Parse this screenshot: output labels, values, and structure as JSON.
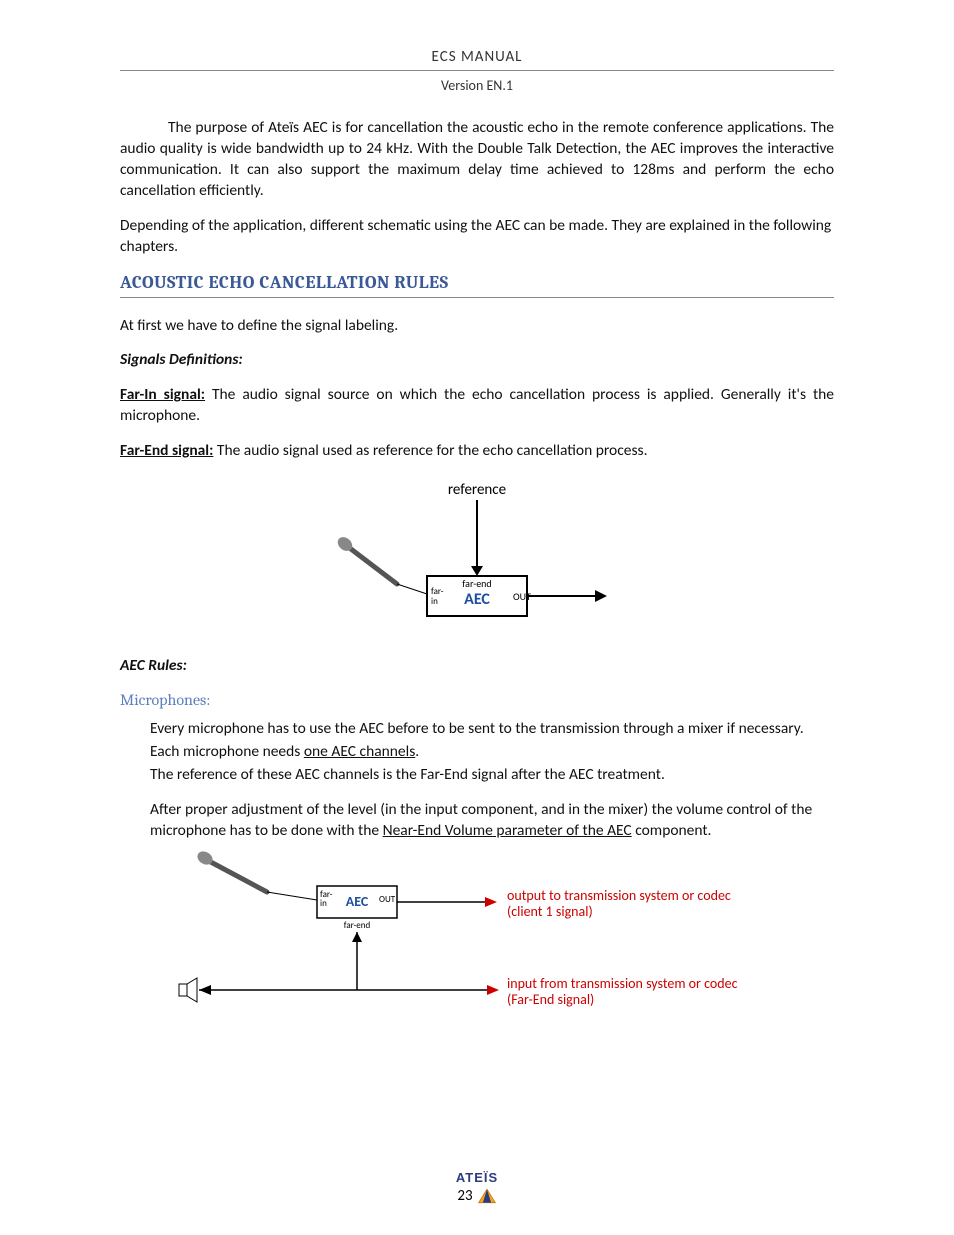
{
  "header": {
    "title": "ECS  MANUAL",
    "version": "Version EN.1"
  },
  "paragraphs": {
    "intro1": "The purpose of Ateïs AEC is for cancellation the acoustic echo in the remote conference applications. The audio quality is wide bandwidth up to 24 kHz. With the Double Talk Detection, the AEC improves the interactive communication. It can also support the maximum delay time achieved to 128ms and perform the echo cancellation efficiently.",
    "intro2": "Depending of the application, different schematic using the AEC can be made. They are explained in the following chapters.",
    "section_heading": "ACOUSTIC ECHO CANCELLATION RULES",
    "atfirst": "At first we have to define the signal labeling.",
    "sigdef_heading": "Signals Definitions:",
    "farin_label": "Far-In signal:",
    "farin_text": " The audio signal source on which the echo cancellation process is applied. Generally it's the microphone.",
    "farend_label": "Far-End signal:",
    "farend_text": "  The audio signal used as reference for the echo cancellation process.",
    "aecrules_heading": "AEC Rules:",
    "mic_heading": "Microphones:",
    "mic_p1": "Every microphone has to use the AEC before to be sent to the transmission through a mixer if necessary.",
    "mic_p2a": "Each microphone needs ",
    "mic_p2_ul": "one AEC channels",
    "mic_p2b": ".",
    "mic_p3": "The reference of these AEC channels is the Far-End signal after the AEC treatment.",
    "mic_p4a": "After proper adjustment of the level (in the input component, and in the mixer) the volume control of the microphone has to be done with the ",
    "mic_p4_ul": "Near-End Volume parameter of the AEC",
    "mic_p4b": " component."
  },
  "diagram1": {
    "reference": "reference",
    "farend": "far-end",
    "farin": "far-\nin",
    "aec": "AEC",
    "out": "OUT"
  },
  "diagram2": {
    "farin": "far-\nin",
    "aec": "AEC",
    "out": "OUT",
    "farend": "far-end",
    "out_label1": "output to transmission system or codec",
    "out_label2": "(client 1 signal)",
    "in_label1": "input from transmission system or codec",
    "in_label2": "(Far-End signal)"
  },
  "footer": {
    "brand": "ATEÏS",
    "page": "23"
  }
}
